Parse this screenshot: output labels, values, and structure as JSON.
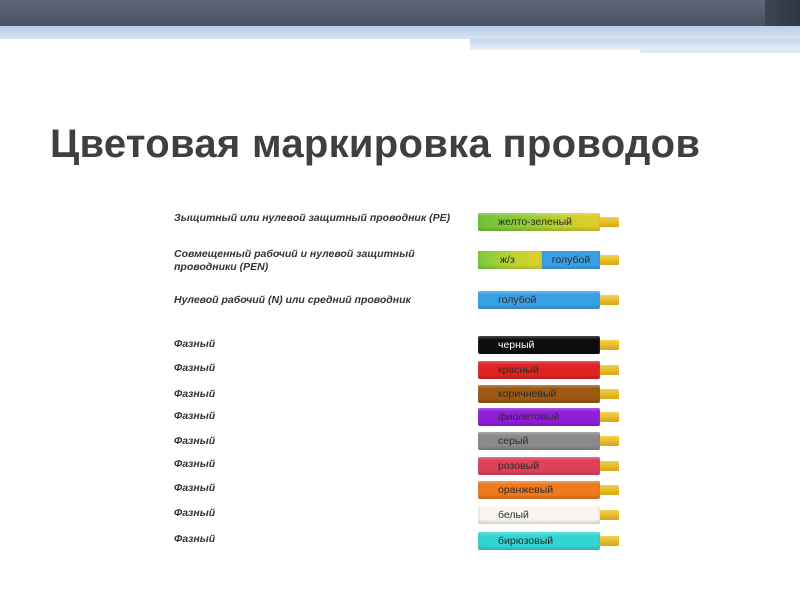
{
  "slide": {
    "title": "Цветовая маркировка проводов"
  },
  "rows": [
    {
      "label": "Зыщитный или нулевой защитный проводник (PE)",
      "wire_label": "желто-зеленый",
      "color": "#78b832",
      "dark": false
    },
    {
      "label": "Совмещенный рабочий и нулевой защитный проводники (PEN)",
      "split": true,
      "wire_label_left": "ж/з",
      "wire_label_right": "голубой",
      "color_left": "#9ccd36",
      "color_right": "#3aa0e6"
    },
    {
      "label": "Нулевой рабочий (N) или средний проводник",
      "wire_label": "голубой",
      "color": "#3aa0e6",
      "dark": false
    },
    {
      "label": "Фазный",
      "wire_label": "черный",
      "color": "#0d0d0d",
      "dark": true
    },
    {
      "label": "Фазный",
      "wire_label": "красный",
      "color": "#e02424",
      "dark": false
    },
    {
      "label": "Фазный",
      "wire_label": "коричневый",
      "color": "#9c5a12",
      "dark": false
    },
    {
      "label": "Фазный",
      "wire_label": "фиолетовый",
      "color": "#8f1fd6",
      "dark": false
    },
    {
      "label": "Фазный",
      "wire_label": "серый",
      "color": "#8b8b8b",
      "dark": false
    },
    {
      "label": "Фазный",
      "wire_label": "розовый",
      "color": "#e0405a",
      "dark": false
    },
    {
      "label": "Фазный",
      "wire_label": "оранжевый",
      "color": "#f07a1e",
      "dark": false
    },
    {
      "label": "Фазный",
      "wire_label": "белый",
      "color": "#f8f6ee",
      "dark": false
    },
    {
      "label": "Фазный",
      "wire_label": "бирюзовый",
      "color": "#35d4d4",
      "dark": false
    }
  ]
}
